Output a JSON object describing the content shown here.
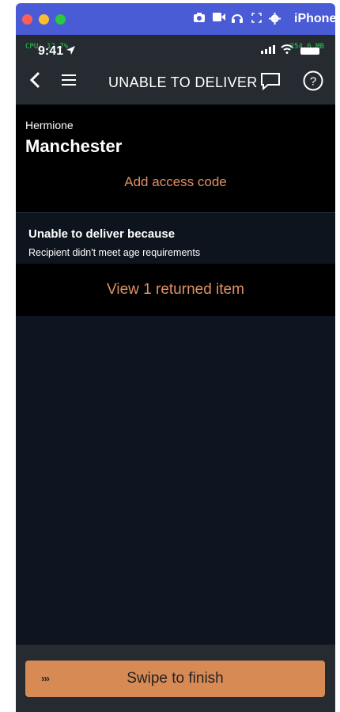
{
  "simulator": {
    "device": "iPhone",
    "controls": {
      "close_color": "#ff5f57",
      "minimize_color": "#febc2e",
      "zoom_color": "#28c840"
    },
    "toolbar_icons": [
      "camera-icon",
      "video-icon",
      "headphones-icon",
      "fullscreen-icon",
      "gear-icon"
    ]
  },
  "status_bar": {
    "time": "9:41",
    "cpu_overlay": "CPU: 12.7%",
    "mem_overlay": "254.6 MB"
  },
  "nav": {
    "title": "UNABLE TO DELIVER"
  },
  "address": {
    "recipient": "Hermione",
    "city": "Manchester",
    "add_access_code": "Add access code"
  },
  "reason": {
    "title": "Unable to deliver because",
    "description": "Recipient didn't meet age requirements"
  },
  "returned": {
    "link": "View 1 returned item"
  },
  "swipe": {
    "chevrons": "›››",
    "label": "Swipe to finish"
  },
  "colors": {
    "accent": "#e09062",
    "swipe_button": "#d88a55",
    "header_bg": "#262b31",
    "screen_bg": "#0e1520",
    "simulator_bar": "#4a5bd6"
  }
}
